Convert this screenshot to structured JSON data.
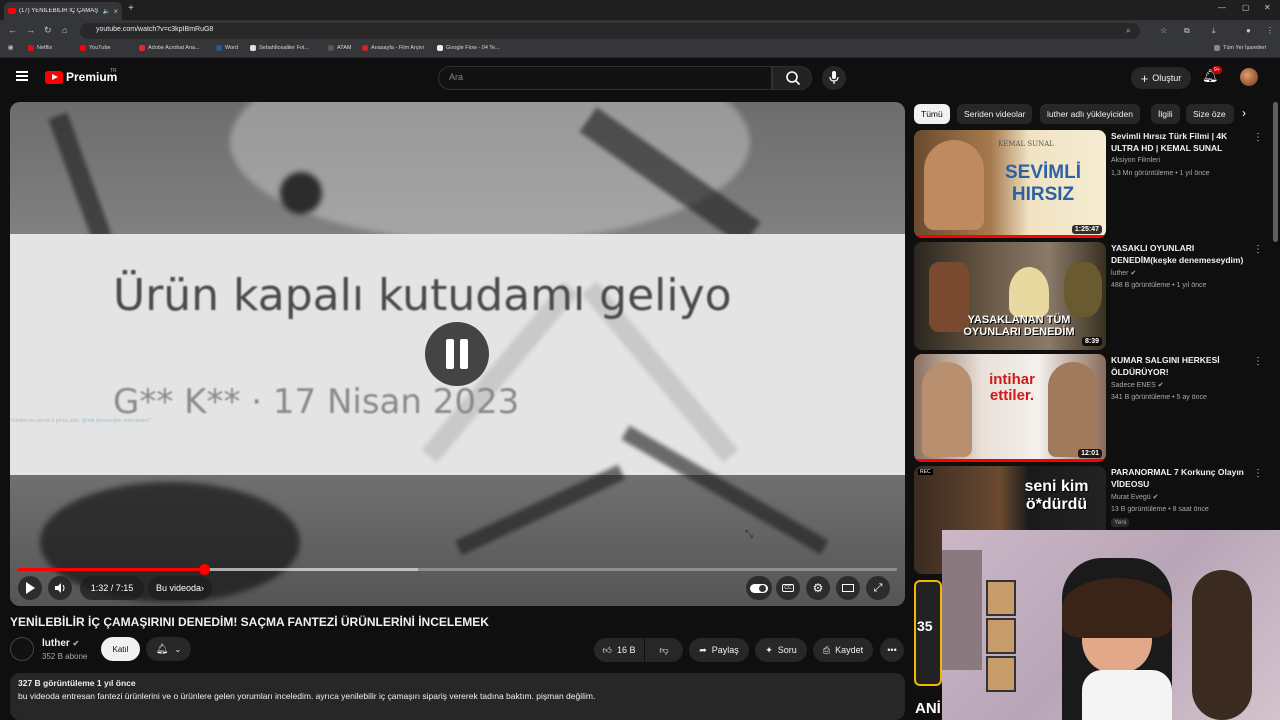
{
  "browser": {
    "tab_title": "(17) YENİLEBİLİR İÇ ÇAMAŞ",
    "url": "youtube.com/watch?v=c3kpIBmRuG8",
    "bookmarks": [
      "Netflix",
      "YouTube",
      "Adobe Acrobat Ana...",
      "Word",
      "Sebahİlosaliler Fot...",
      "ATAM",
      "Anasayfa - Film Arşivi",
      "Google Flow - 04 Te..."
    ],
    "all_bookmarks": "Tüm Yer İşaretleri"
  },
  "masthead": {
    "brand": "Premium",
    "brand_region": "TR",
    "search_placeholder": "Ara",
    "create_label": "Oluştur",
    "notif_badge": "9+"
  },
  "player": {
    "overlay_title": "Ürün kapalı kutudamı geliyo",
    "overlay_sub": "G** K**  ·  17 Nisan 2023",
    "chat_overlay": "Yeniden bu ayrıntı 6 görüş oldu. Şimdi izleyeceğim ama neden?",
    "time": "1:32 / 7:15",
    "chapter_label": "Bu videoda",
    "progress_played": 0.212,
    "progress_buffered": 0.455
  },
  "video": {
    "title": "YENİLEBİLİR İÇ ÇAMAŞIRINI DENEDİM! SAÇMA FANTEZİ ÜRÜNLERİNİ İNCELEMEK",
    "channel": "luther",
    "subscribers": "352 B abone",
    "join_label": "Katıl",
    "likes": "16 B",
    "share_label": "Paylaş",
    "ask_label": "Soru",
    "save_label": "Kaydet",
    "views_date": "327 B görüntüleme  1 yıl önce",
    "description": "bu videoda entresan fantezi ürünlerini ve o ürünlere gelen yorumları inceledim. ayrıca yenilebilir iç çamaşırı sipariş vererek tadına baktım. pişman değilim."
  },
  "chips": [
    "Tümü",
    "Seriden videolar",
    "luther adlı yükleyiciden",
    "İlgili",
    "Size öze"
  ],
  "recommendations": [
    {
      "title": "Sevimli Hırsız Türk Filmi | 4K ULTRA HD | KEMAL SUNAL",
      "channel": "Aksiyon Filmleri",
      "meta": "1,3 Mn görüntüleme • 1 yıl önce",
      "duration": "1:25:47",
      "thumb_text_top": "KEMAL SUNAL",
      "thumb_text": "SEVİMLİ HIRSIZ"
    },
    {
      "title": "YASAKLI OYUNLARI DENEDİM(keşke denemeseydim)",
      "channel": "luther",
      "meta": "488 B görüntüleme • 1 yıl önce",
      "duration": "8:39",
      "thumb_text": "YASAKLANAN TÜM OYUNLARI DENEDİM"
    },
    {
      "title": "KUMAR SALGINI HERKESİ ÖLDÜRÜYOR!",
      "channel": "Sadece ENES",
      "meta": "341 B görüntüleme • 5 ay önce",
      "duration": "12:01",
      "thumb_text": "intihar ettiler."
    },
    {
      "title": "PARANORMAL 7 Korkunç Olayın VİDEOSU",
      "channel": "Murat Evegü",
      "meta": "13 B görüntüleme • 8 saat önce",
      "new_tag": "Yeni",
      "thumb_text": "seni kim ö*dürdü"
    }
  ],
  "side_labels": {
    "partial1": "35",
    "partial2": "ANİ"
  },
  "colors": {
    "accent": "#ff0000",
    "bg": "#0f0f0f",
    "chip": "#272727"
  }
}
